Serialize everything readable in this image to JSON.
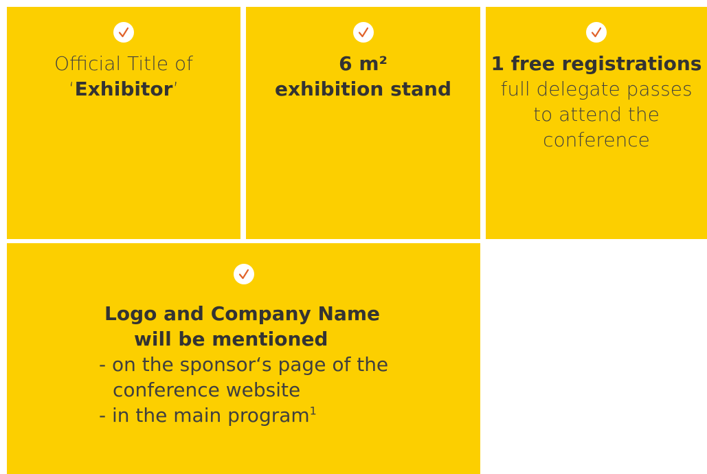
{
  "cards": [
    {
      "icon": "check-icon",
      "line1": "Official Title of",
      "line2_pre": "‘",
      "line2_bold": "Exhibitor",
      "line2_post": "’"
    },
    {
      "icon": "check-icon",
      "line1": "6 m²",
      "line2": "exhibition stand"
    },
    {
      "icon": "check-icon",
      "line1": "1 free registrations",
      "line2": "full delegate passes",
      "line3": "to attend the",
      "line4": "conference"
    },
    {
      "icon": "check-icon",
      "headline1": "Logo and Company Name",
      "headline2": "will be mentioned",
      "bullet1": "- on the sponsor‘s page of the",
      "bullet1_cont": "conference website",
      "bullet2": "- in the main program",
      "bullet2_sup": "1"
    }
  ],
  "colors": {
    "card_bg": "#fccf00",
    "check_accent": "#e0622a",
    "text": "#3f3f3f"
  }
}
